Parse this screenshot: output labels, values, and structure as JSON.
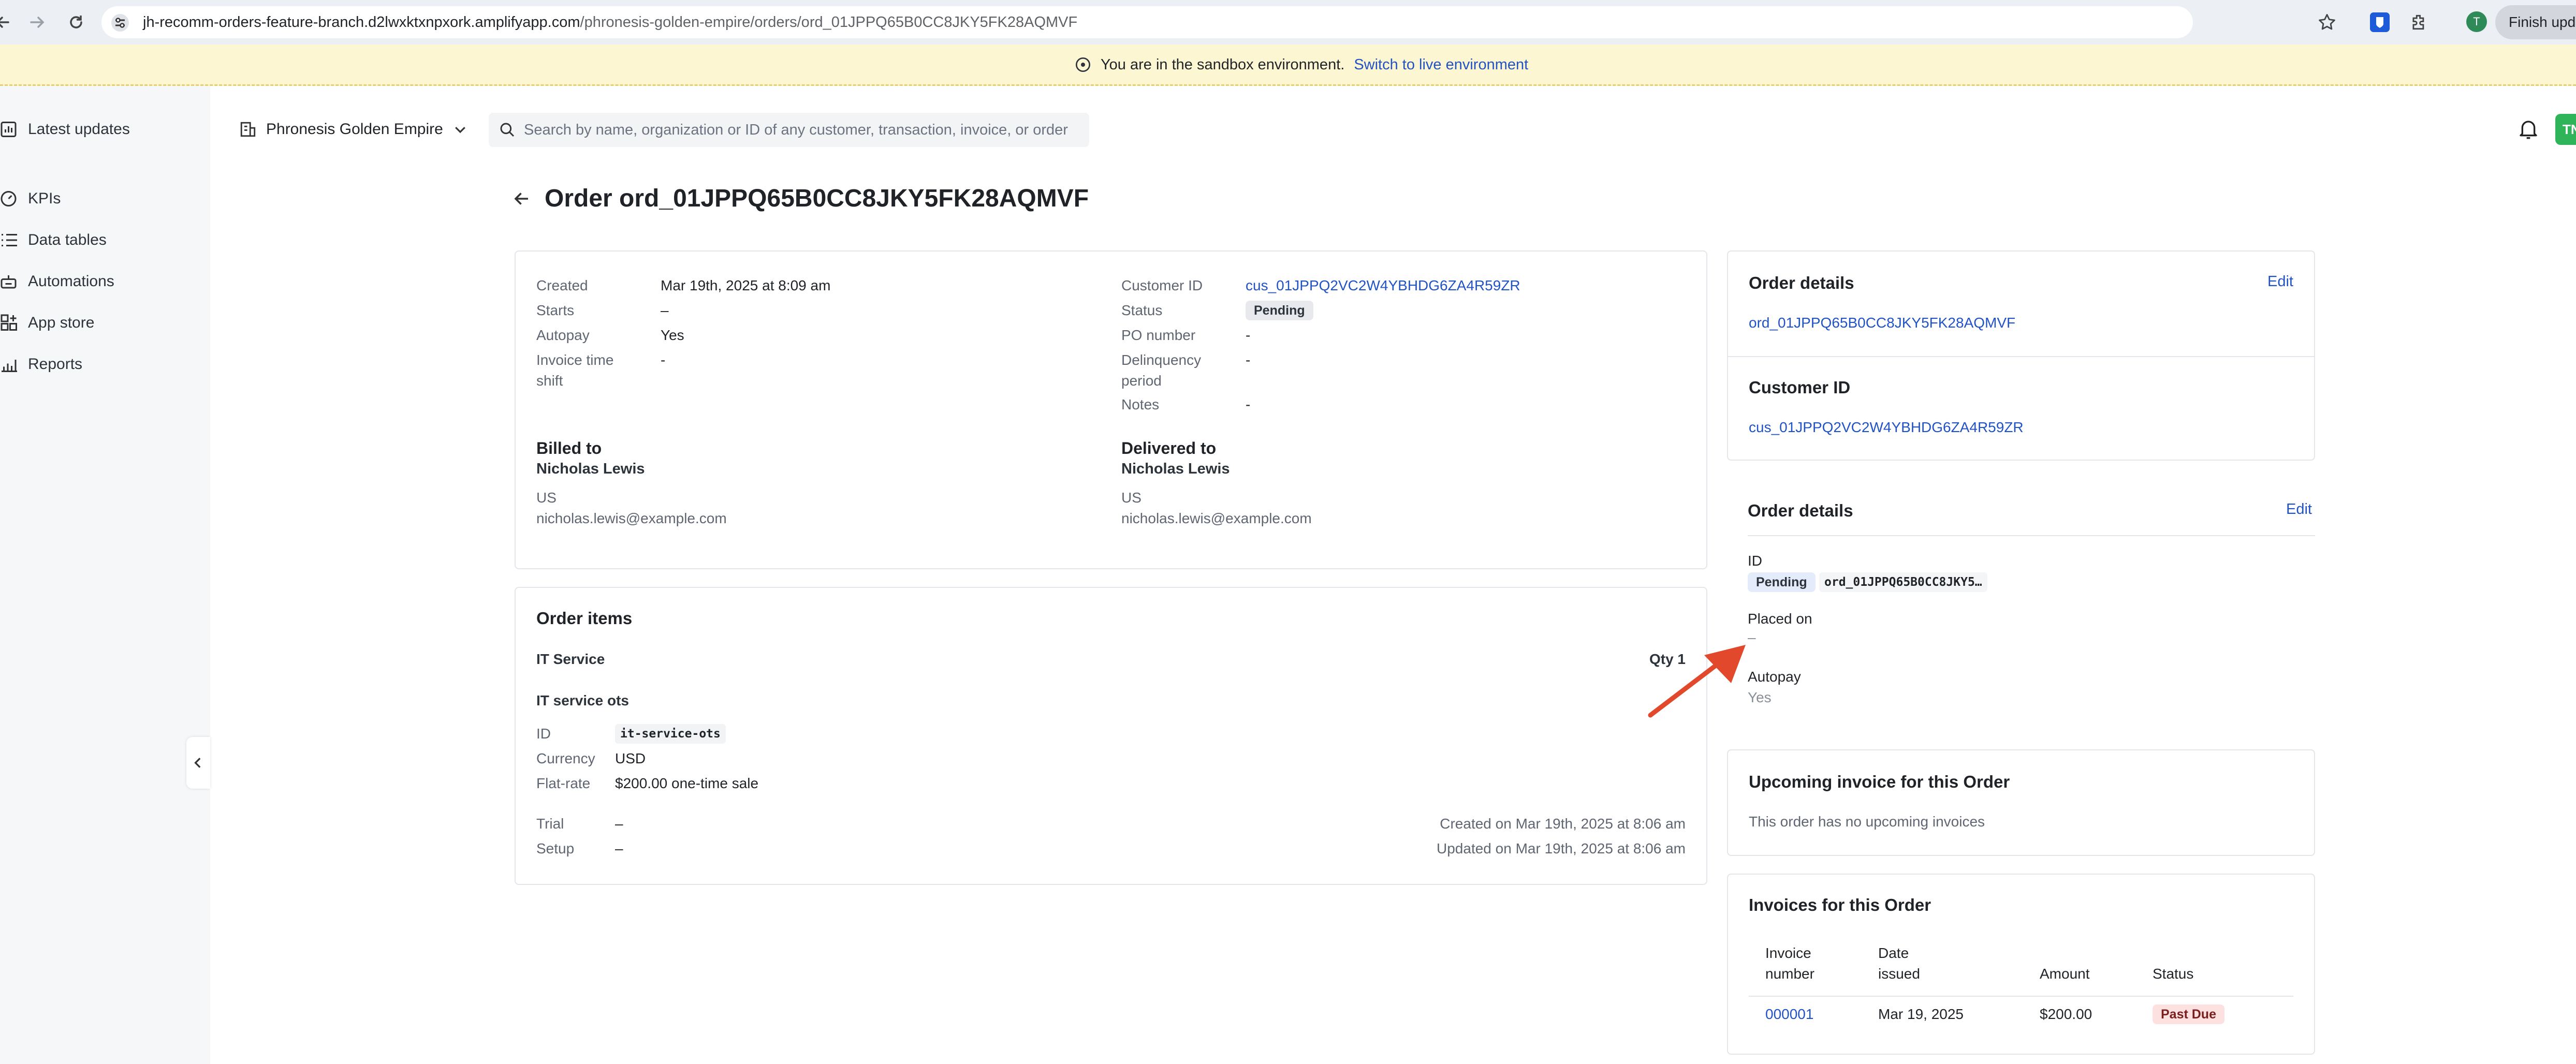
{
  "browser": {
    "url_host": "jh-recomm-orders-feature-branch.d2lwxktxnpxork.amplifyapp.com",
    "url_path": "/phronesis-golden-empire/orders/ord_01JPPQ65B0CC8JKY5FK28AQMVF",
    "profile_initial": "T",
    "update_button": "Finish update"
  },
  "banner": {
    "text": "You are in the sandbox environment.",
    "link": "Switch to live environment"
  },
  "sidebar": {
    "items": [
      {
        "label": "Latest updates",
        "icon": "chart-icon"
      },
      {
        "label": "KPIs",
        "icon": "gauge-icon"
      },
      {
        "label": "Data tables",
        "icon": "list-icon"
      },
      {
        "label": "Automations",
        "icon": "robot-icon"
      },
      {
        "label": "App store",
        "icon": "grid-plus-icon"
      },
      {
        "label": "Reports",
        "icon": "bar-chart-icon"
      }
    ]
  },
  "topbar": {
    "org_name": "Phronesis Golden Empire",
    "search_placeholder": "Search by name, organization or ID of any customer, transaction, invoice, or order",
    "avatar_initials": "TN"
  },
  "page": {
    "title": "Order ord_01JPPQ65B0CC8JKY5FK28AQMVF"
  },
  "summary": {
    "left_fields": [
      {
        "label": "Created",
        "value": "Mar 19th, 2025 at 8:09 am"
      },
      {
        "label": "Starts",
        "value": "–"
      },
      {
        "label": "Autopay",
        "value": "Yes"
      },
      {
        "label": "Invoice time shift",
        "value": "-"
      }
    ],
    "customer_id_label": "Customer ID",
    "customer_id": "cus_01JPPQ2VC2W4YBHDG6ZA4R59ZR",
    "status_label": "Status",
    "status": "Pending",
    "po_label": "PO number",
    "po_value": "-",
    "delinquency_label": "Delinquency period",
    "delinquency_value": "-",
    "notes_label": "Notes",
    "notes_value": "-",
    "billed_to": {
      "heading": "Billed to",
      "name": "Nicholas Lewis",
      "country": "US",
      "email": "nicholas.lewis@example.com"
    },
    "delivered_to": {
      "heading": "Delivered to",
      "name": "Nicholas Lewis",
      "country": "US",
      "email": "nicholas.lewis@example.com"
    }
  },
  "order_items": {
    "heading": "Order items",
    "product": "IT Service",
    "qty": "Qty 1",
    "plan": "IT service ots",
    "id_label": "ID",
    "id_value": "it-service-ots",
    "currency_label": "Currency",
    "currency_value": "USD",
    "flatrate_label": "Flat-rate",
    "flatrate_value": "$200.00 one-time sale",
    "trial_label": "Trial",
    "trial_value": "–",
    "setup_label": "Setup",
    "setup_value": "–",
    "created_on": "Created on Mar 19th, 2025 at 8:06 am",
    "updated_on": "Updated on Mar 19th, 2025 at 8:06 am"
  },
  "right_panel": {
    "order_details_card": {
      "heading": "Order details",
      "edit": "Edit",
      "order_id": "ord_01JPPQ65B0CC8JKY5FK28AQMVF",
      "customer_heading": "Customer ID",
      "customer_id": "cus_01JPPQ2VC2W4YBHDG6ZA4R59ZR"
    },
    "order_details_section": {
      "heading": "Order details",
      "edit": "Edit",
      "id_label": "ID",
      "status": "Pending",
      "id_value": "ord_01JPPQ65B0CC8JKY5…",
      "placed_label": "Placed on",
      "placed_value": "–",
      "autopay_label": "Autopay",
      "autopay_value": "Yes"
    },
    "upcoming": {
      "heading": "Upcoming invoice for this Order",
      "text": "This order has no upcoming invoices"
    },
    "invoices": {
      "heading": "Invoices for this Order",
      "col_number": [
        "Invoice",
        "number"
      ],
      "col_date": [
        "Date",
        "issued"
      ],
      "col_amount": "Amount",
      "col_status": "Status",
      "rows": [
        {
          "number": "000001",
          "date": "Mar 19, 2025",
          "amount": "$200.00",
          "status": "Past Due"
        }
      ]
    }
  },
  "colors": {
    "link": "#2153c4",
    "banner_bg": "#fdf6d2",
    "avatar_bg": "#2fb45a",
    "annotation_arrow": "#e2482c"
  }
}
